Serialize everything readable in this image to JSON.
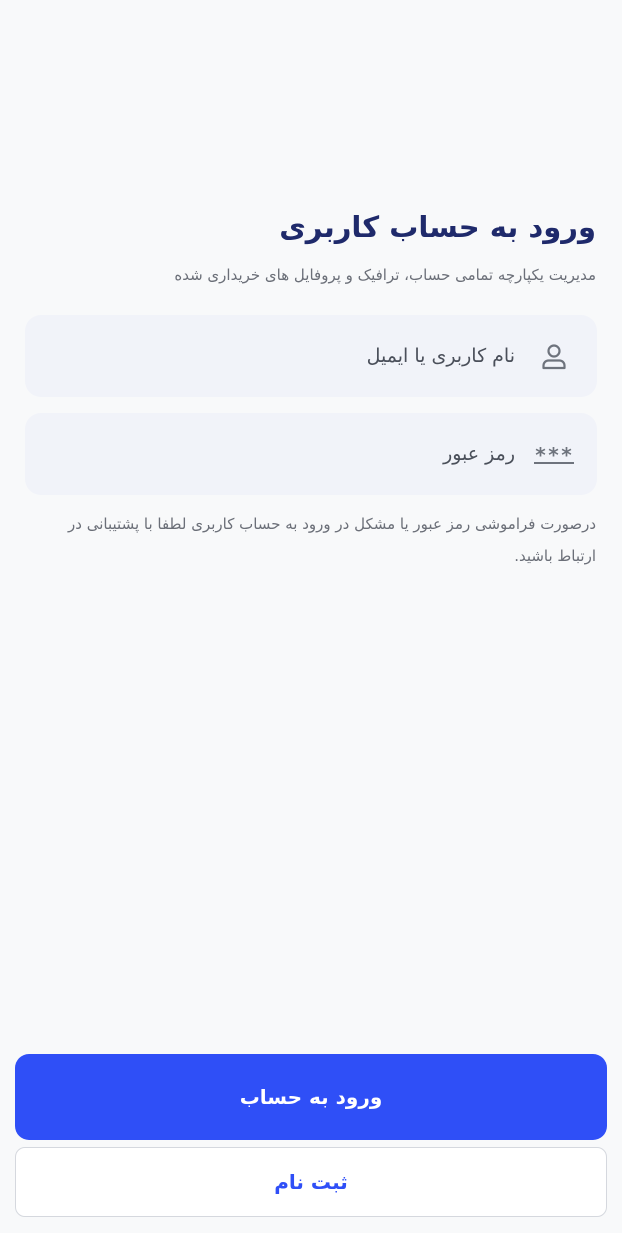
{
  "login": {
    "title": "ورود به حساب کاربری",
    "subtitle": "مدیریت یکپارچه تمامی حساب، ترافیک و پروفایل های خریداری شده",
    "username_placeholder": "نام کاربری یا ایمیل",
    "username_icon": "user-icon",
    "password_placeholder": "رمز عبور",
    "password_icon": "password-stars-icon",
    "password_icon_text": "***",
    "note": "درصورت فراموشی رمز عبور یا مشکل در ورود به حساب کاربری لطفا با پشتیبانی در ارتباط باشید.",
    "login_button": "ورود به حساب",
    "register_button": "ثبت نام"
  },
  "colors": {
    "primary": "#2f4ff7",
    "title": "#1f2a6b",
    "field_bg": "#f1f3f9",
    "page_bg": "#f8f9fa"
  }
}
